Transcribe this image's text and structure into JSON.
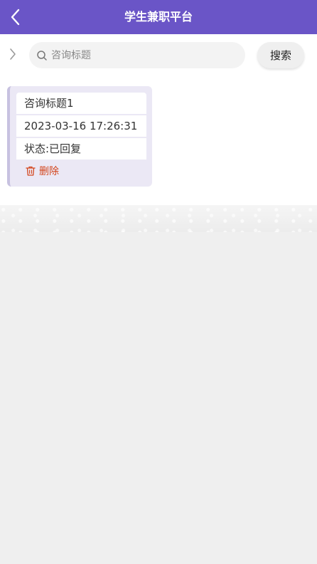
{
  "header": {
    "title": "学生兼职平台",
    "accent_color": "#6a55c7",
    "back_icon": "chevron-left-icon"
  },
  "search": {
    "expand_icon": "chevron-right-icon",
    "icon": "search-icon",
    "placeholder": "咨询标题",
    "value": "",
    "button_label": "搜索"
  },
  "list": {
    "items": [
      {
        "title": "咨询标题1",
        "time": "2023-03-16 17:26:31",
        "status": "状态:已回复",
        "delete_label": "删除",
        "delete_icon": "trash-icon",
        "delete_color": "#d3451c"
      }
    ]
  }
}
